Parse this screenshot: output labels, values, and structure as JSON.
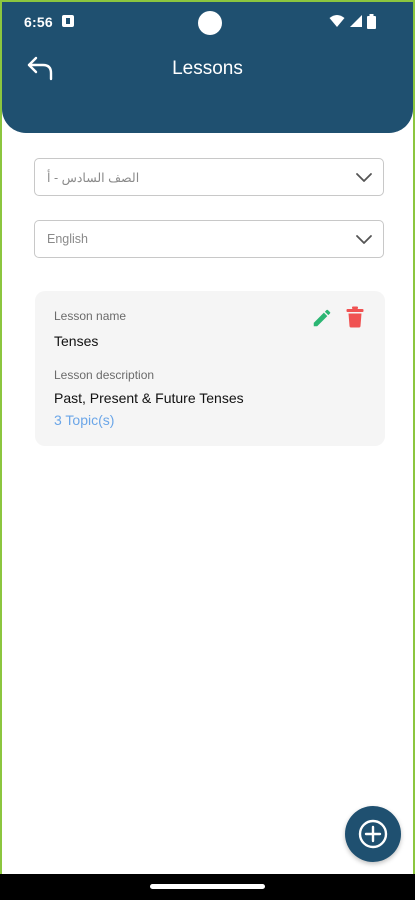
{
  "status_bar": {
    "time": "6:56"
  },
  "header": {
    "title": "Lessons",
    "back_icon": "back-arrow-icon"
  },
  "filters": {
    "class_select": {
      "value": "الصف السادس - أ"
    },
    "subject_select": {
      "value": "English"
    }
  },
  "lesson_card": {
    "name_label": "Lesson name",
    "name_value": "Tenses",
    "description_label": "Lesson description",
    "description_value": "Past, Present & Future Tenses",
    "topics_link": "3 Topic(s)"
  },
  "colors": {
    "primary": "#1f5070",
    "edit": "#2bb673",
    "delete": "#f05252",
    "link": "#6ba6e8",
    "card_bg": "#f5f5f5",
    "frame_border": "#8cc63f"
  },
  "fab": {
    "icon": "add-circle-icon"
  }
}
